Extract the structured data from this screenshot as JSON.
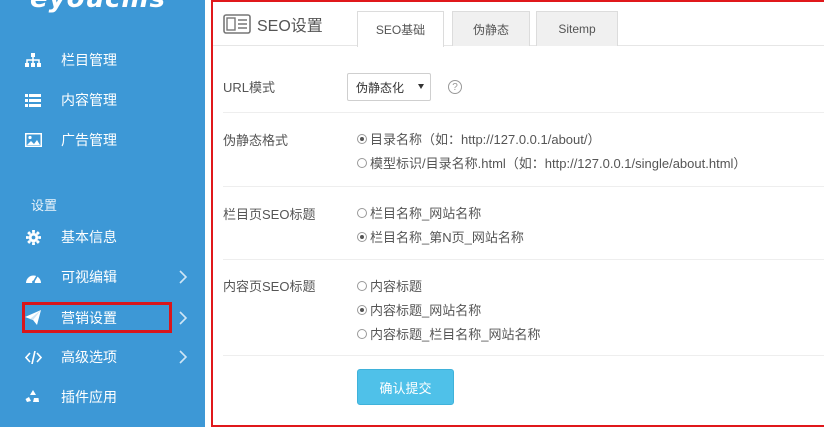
{
  "brand": {
    "logo_text": "eyoucms"
  },
  "sidebar": {
    "items": [
      {
        "label": "栏目管理",
        "icon": "sitemap-icon"
      },
      {
        "label": "内容管理",
        "icon": "list-icon"
      },
      {
        "label": "广告管理",
        "icon": "image-icon"
      }
    ],
    "settings_label": "设置",
    "settings_items": [
      {
        "label": "基本信息",
        "icon": "gear-icon"
      },
      {
        "label": "可视编辑",
        "icon": "dashboard-icon"
      },
      {
        "label": "营销设置",
        "icon": "paper-plane-icon"
      },
      {
        "label": "高级选项",
        "icon": "code-icon"
      },
      {
        "label": "插件应用",
        "icon": "recycle-icon"
      }
    ]
  },
  "panel": {
    "title": "SEO设置",
    "tabs": [
      {
        "label": "SEO基础",
        "active": true
      },
      {
        "label": "伪静态",
        "active": false
      },
      {
        "label": "Sitemp",
        "active": false
      }
    ]
  },
  "form": {
    "url_mode": {
      "label": "URL模式",
      "value": "伪静态化",
      "help": "?"
    },
    "rewrite_format": {
      "label": "伪静态格式",
      "options": [
        {
          "text": "目录名称（如：http://127.0.0.1/about/）",
          "checked": true
        },
        {
          "text": "模型标识/目录名称.html（如：http://127.0.0.1/single/about.html）",
          "checked": false
        }
      ]
    },
    "column_seo_title": {
      "label": "栏目页SEO标题",
      "options": [
        {
          "text": "栏目名称_网站名称",
          "checked": false
        },
        {
          "text": "栏目名称_第N页_网站名称",
          "checked": true
        }
      ]
    },
    "content_seo_title": {
      "label": "内容页SEO标题",
      "options": [
        {
          "text": "内容标题",
          "checked": false
        },
        {
          "text": "内容标题_网站名称",
          "checked": true
        },
        {
          "text": "内容标题_栏目名称_网站名称",
          "checked": false
        }
      ]
    },
    "submit_label": "确认提交"
  },
  "colors": {
    "sidebar_bg": "#3d98d6",
    "highlight": "#d9161b",
    "button": "#4fc1e9"
  }
}
